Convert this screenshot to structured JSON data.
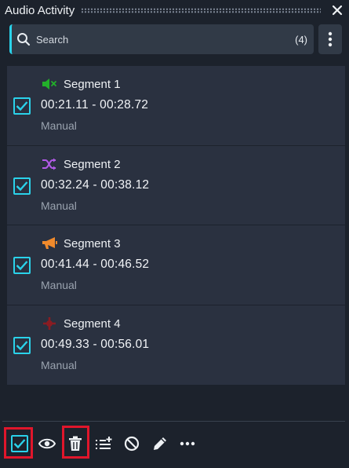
{
  "window": {
    "title": "Audio Activity",
    "close_icon": "close-icon"
  },
  "search": {
    "placeholder": "Search",
    "count": "(4)",
    "icon": "search-icon"
  },
  "menu": {
    "icon": "kebab-vertical-icon"
  },
  "segments": [
    {
      "name": "Segment 1",
      "time": "00:21.11 - 00:28.72",
      "type": "Manual",
      "icon": "speaker-mute-icon",
      "icon_color": "#22b02a",
      "checked": true
    },
    {
      "name": "Segment 2",
      "time": "00:32.24 - 00:38.12",
      "type": "Manual",
      "icon": "shuffle-icon",
      "icon_color": "#b15ae6",
      "checked": true
    },
    {
      "name": "Segment 3",
      "time": "00:41.44 - 00:46.52",
      "type": "Manual",
      "icon": "megaphone-icon",
      "icon_color": "#f08a2c",
      "checked": true
    },
    {
      "name": "Segment 4",
      "time": "00:49.33 - 00:56.01",
      "type": "Manual",
      "icon": "cross-marker-icon",
      "icon_color": "#8a1c22",
      "checked": true
    }
  ],
  "toolbar": {
    "items": [
      "select-all-checkbox",
      "eye-icon",
      "trash-icon",
      "add-list-icon",
      "block-icon",
      "pencil-icon",
      "more-horizontal-icon"
    ],
    "highlight_color": "#e0162b",
    "accent": "#2ad2ea"
  }
}
